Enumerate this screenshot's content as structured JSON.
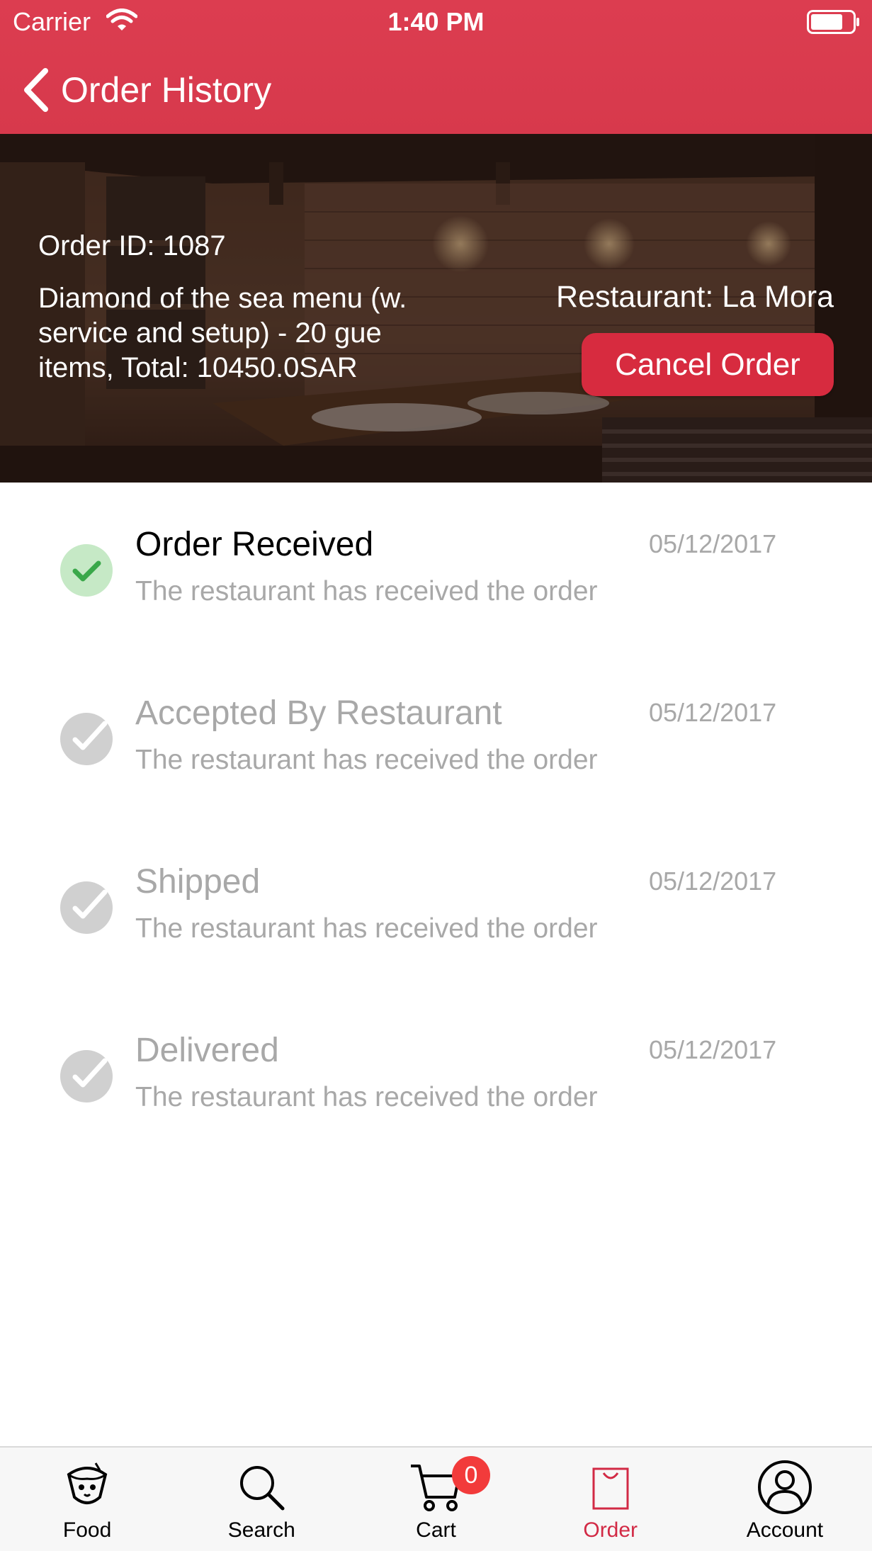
{
  "status_bar": {
    "carrier": "Carrier",
    "time": "1:40 PM"
  },
  "nav": {
    "back_label": "Order History"
  },
  "order": {
    "id_text": "Order ID: 1087",
    "desc_line1": "Diamond of the sea menu (w.",
    "desc_line2": "service and setup)  - 20 gue",
    "desc_line3": "items, Total: 10450.0SAR",
    "restaurant_text": "Restaurant: La Mora",
    "cancel_label": "Cancel Order"
  },
  "steps": [
    {
      "title": "Order Received",
      "date": "05/12/2017",
      "desc": "The restaurant has received the order",
      "done": true
    },
    {
      "title": "Accepted By Restaurant",
      "date": "05/12/2017",
      "desc": "The restaurant has received the order",
      "done": false
    },
    {
      "title": "Shipped",
      "date": "05/12/2017",
      "desc": "The restaurant has received the order",
      "done": false
    },
    {
      "title": "Delivered",
      "date": "05/12/2017",
      "desc": "The restaurant has received the order",
      "done": false
    }
  ],
  "tabs": [
    {
      "label": "Food",
      "icon": "food-icon"
    },
    {
      "label": "Search",
      "icon": "search-icon"
    },
    {
      "label": "Cart",
      "icon": "cart-icon"
    },
    {
      "label": "Order",
      "icon": "order-bag-icon"
    },
    {
      "label": "Account",
      "icon": "account-icon"
    }
  ],
  "cart_count": "0",
  "colors": {
    "brand_red": "#d72b3f",
    "active_tab": "#d22a45",
    "done_green": "#3aa84a",
    "muted_gray": "#a8a8a8"
  }
}
